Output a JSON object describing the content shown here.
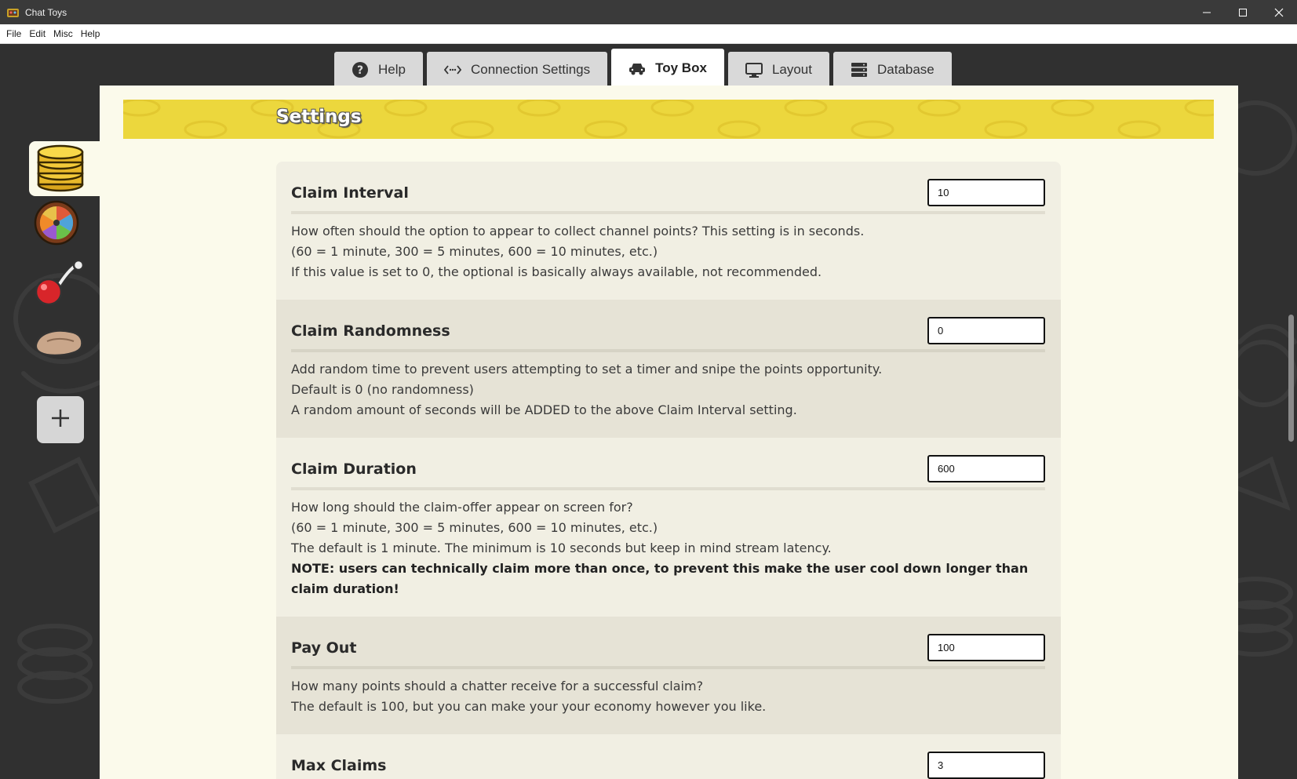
{
  "window": {
    "title": "Chat Toys",
    "controls": [
      "minimize-icon",
      "maximize-icon",
      "close-icon"
    ]
  },
  "menu": [
    "File",
    "Edit",
    "Misc",
    "Help"
  ],
  "tabs": [
    {
      "label": "Help",
      "icon": "question-circle-icon",
      "active": false
    },
    {
      "label": "Connection Settings",
      "icon": "code-arrows-icon",
      "active": false
    },
    {
      "label": "Toy Box",
      "icon": "car-icon",
      "active": true
    },
    {
      "label": "Layout",
      "icon": "monitor-icon",
      "active": false
    },
    {
      "label": "Database",
      "icon": "database-icon",
      "active": false
    }
  ],
  "sidebar": {
    "items": [
      {
        "icon": "coin-stack-icon",
        "active": true
      },
      {
        "icon": "prize-wheel-icon",
        "active": false
      },
      {
        "icon": "rattle-toy-icon",
        "active": false
      },
      {
        "icon": "hand-icon",
        "active": false
      }
    ],
    "add_icon": "plus-icon"
  },
  "section_title": "Settings",
  "settings": [
    {
      "name": "Claim Interval",
      "value": "10",
      "desc": [
        "How often should the option to appear to collect channel points? This setting is in seconds.",
        "(60 = 1 minute, 300 = 5 minutes, 600 = 10 minutes, etc.)",
        "If this value is set to 0, the optional is basically always available, not recommended."
      ],
      "note": ""
    },
    {
      "name": "Claim Randomness",
      "value": "0",
      "desc": [
        "Add random time to prevent users attempting to set a timer and snipe the points opportunity.",
        "Default is 0 (no randomness)",
        "A random amount of seconds will be ADDED to the above Claim Interval setting."
      ],
      "note": ""
    },
    {
      "name": "Claim Duration",
      "value": "600",
      "desc": [
        "How long should the claim-offer appear on screen for?",
        "(60 = 1 minute, 300 = 5 minutes, 600 = 10 minutes, etc.)",
        "The default is 1 minute. The minimum is 10 seconds but keep in mind stream latency."
      ],
      "note": "NOTE: users can technically claim more than once, to prevent this make the user cool down longer than claim duration!"
    },
    {
      "name": "Pay Out",
      "value": "100",
      "desc": [
        "How many points should a chatter receive for a successful claim?",
        "The default is 100, but you can make your your economy however you like."
      ],
      "note": ""
    },
    {
      "name": "Max Claims",
      "value": "3",
      "desc": [],
      "note": ""
    }
  ],
  "colors": {
    "banner": "#ecd73d",
    "content_bg": "#fbfaeb",
    "row_light": "#f1efe3",
    "row_dark": "#e6e3d6",
    "workspace_bg": "#303030"
  }
}
